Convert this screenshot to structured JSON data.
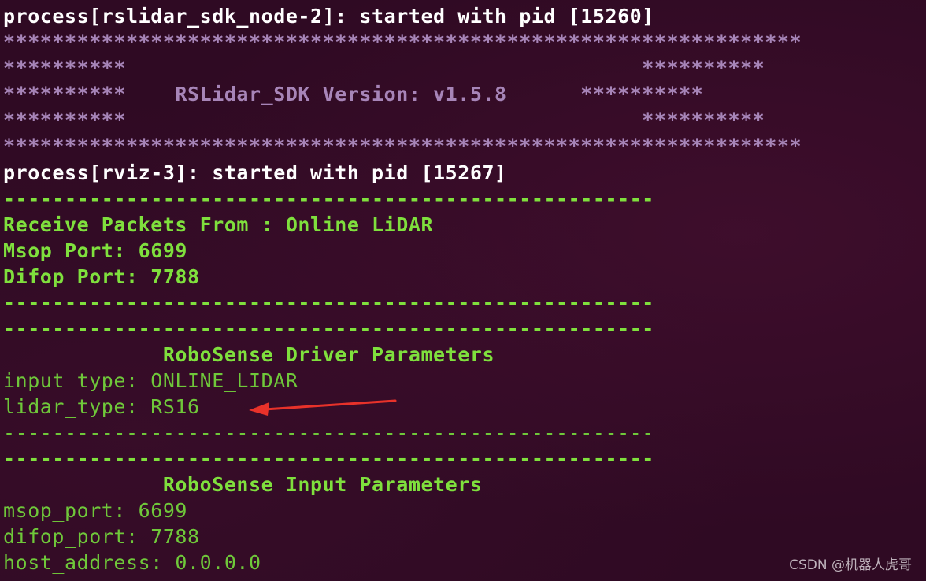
{
  "terminal": {
    "lines": [
      {
        "text": "process[rslidar_sdk_node-2]: started with pid [15260]",
        "color": "#ffffff"
      },
      {
        "text": "*****************************************************************",
        "color": "#a785b8"
      },
      {
        "text": "**********                                          **********",
        "color": "#a785b8"
      },
      {
        "text": "**********    RSLidar_SDK Version: v1.5.8      **********",
        "color": "#a785b8"
      },
      {
        "text": "**********                                          **********",
        "color": "#a785b8"
      },
      {
        "text": "*****************************************************************",
        "color": "#a785b8"
      },
      {
        "text": "process[rviz-3]: started with pid [15267]",
        "color": "#ffffff"
      },
      {
        "text": "-----------------------------------------------------",
        "color": "#7fe03d"
      },
      {
        "text": "Receive Packets From : Online LiDAR",
        "color": "#7fe03d"
      },
      {
        "text": "Msop Port: 6699",
        "color": "#7fe03d"
      },
      {
        "text": "Difop Port: 7788",
        "color": "#7fe03d"
      },
      {
        "text": "-----------------------------------------------------",
        "color": "#7fe03d"
      },
      {
        "text": "-----------------------------------------------------",
        "color": "#7fe03d"
      },
      {
        "text": "             RoboSense Driver Parameters",
        "color": "#7fe03d"
      },
      {
        "text": "input type: ONLINE_LIDAR",
        "color": "#6fc83a"
      },
      {
        "text": "lidar_type: RS16",
        "color": "#6fc83a"
      },
      {
        "text": "-----------------------------------------------------",
        "color": "#6fc83a"
      },
      {
        "text": "-----------------------------------------------------",
        "color": "#7fe03d"
      },
      {
        "text": "             RoboSense Input Parameters",
        "color": "#7fe03d"
      },
      {
        "text": "msop_port: 6699",
        "color": "#6fc83a"
      },
      {
        "text": "difop_port: 7788",
        "color": "#6fc83a"
      },
      {
        "text": "host_address: 0.0.0.0",
        "color": "#6fc83a"
      }
    ]
  },
  "annotation": {
    "arrow_color": "#e8322a",
    "arrow_target": "lidar_type: RS16"
  },
  "watermark": "CSDN @机器人虎哥"
}
